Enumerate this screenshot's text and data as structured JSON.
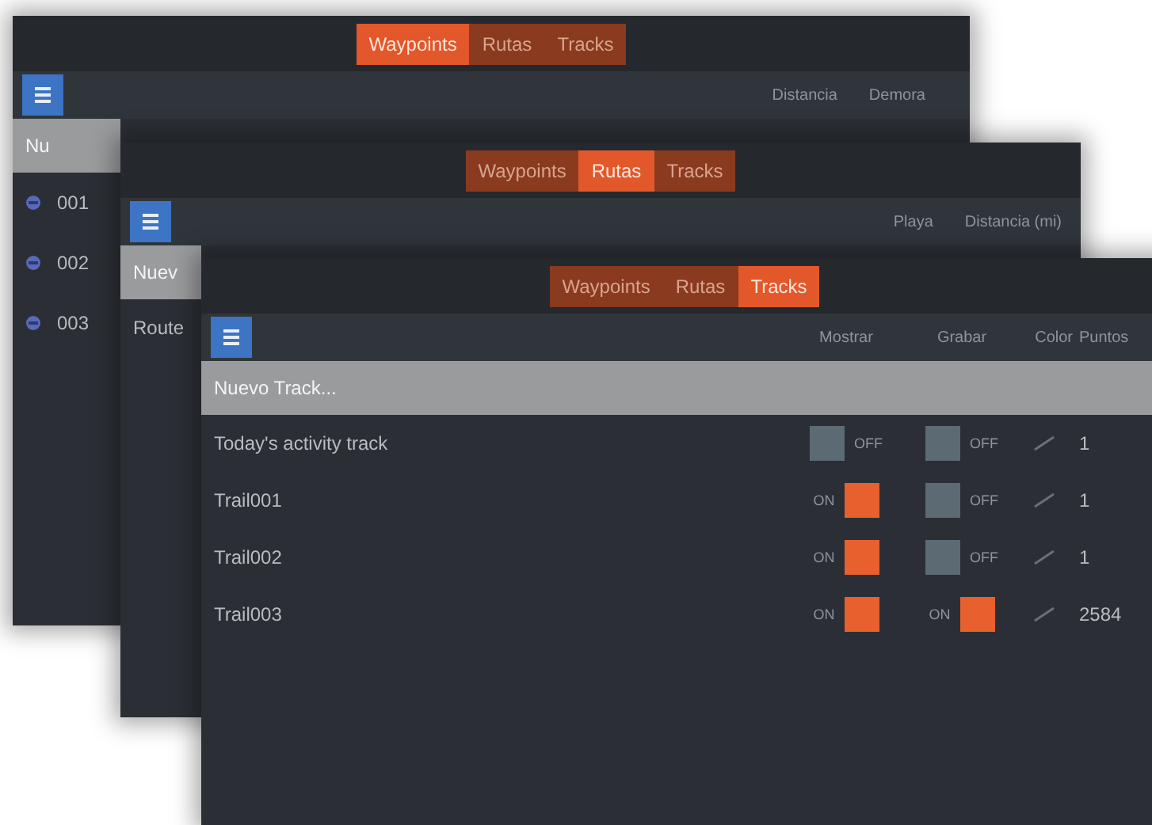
{
  "screens": [
    {
      "kind": "waypoints",
      "tabs": [
        {
          "label": "Waypoints",
          "selected": true
        },
        {
          "label": "Rutas",
          "selected": false
        },
        {
          "label": "Tracks",
          "selected": false
        }
      ],
      "columns": [
        "Distancia",
        "Demora"
      ],
      "new_row": "Nu",
      "rows": [
        {
          "name": "001"
        },
        {
          "name": "002"
        },
        {
          "name": "003"
        }
      ]
    },
    {
      "kind": "routes",
      "tabs": [
        {
          "label": "Waypoints",
          "selected": false
        },
        {
          "label": "Rutas",
          "selected": true
        },
        {
          "label": "Tracks",
          "selected": false
        }
      ],
      "columns": [
        "Playa",
        "Distancia (mi)"
      ],
      "new_row": "Nuev",
      "rows": [
        {
          "name": "Route"
        }
      ]
    },
    {
      "kind": "tracks",
      "tabs": [
        {
          "label": "Waypoints",
          "selected": false
        },
        {
          "label": "Rutas",
          "selected": false
        },
        {
          "label": "Tracks",
          "selected": true
        }
      ],
      "columns": [
        "Mostrar",
        "Grabar",
        "Color",
        "Puntos"
      ],
      "new_row": "Nuevo Track...",
      "rows": [
        {
          "name": "Today's activity track",
          "show": {
            "label": "OFF",
            "on": false
          },
          "record": {
            "label": "OFF",
            "on": false
          },
          "points": "1"
        },
        {
          "name": "Trail001",
          "show": {
            "label": "ON",
            "on": true
          },
          "record": {
            "label": "OFF",
            "on": false
          },
          "points": "1"
        },
        {
          "name": "Trail002",
          "show": {
            "label": "ON",
            "on": true
          },
          "record": {
            "label": "OFF",
            "on": false
          },
          "points": "1"
        },
        {
          "name": "Trail003",
          "show": {
            "label": "ON",
            "on": true
          },
          "record": {
            "label": "ON",
            "on": true
          },
          "points": "2584"
        }
      ]
    }
  ]
}
